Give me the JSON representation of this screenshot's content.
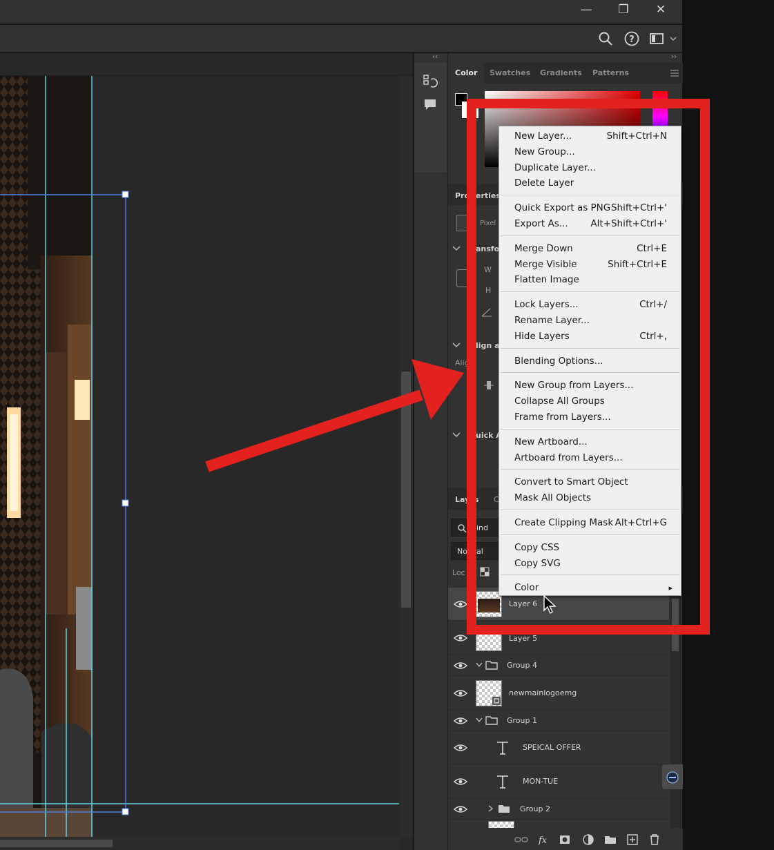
{
  "window": {
    "minimize_glyph": "—",
    "restore_glyph": "❐",
    "close_glyph": "✕"
  },
  "panel": {
    "collapse_left": "‹‹",
    "collapse_right": "››",
    "color_tabs": [
      "Color",
      "Swatches",
      "Gradients",
      "Patterns"
    ],
    "properties_label": "Pro",
    "properties_label_tail": "erties",
    "pixel_label": "Pixel",
    "transform_label": "ansfo",
    "w_label": "W",
    "h_label": "H",
    "align_label": "lign ar",
    "align_sub": "Alig",
    "quick_label": "uick A",
    "layers_tab": "Lay",
    "layers_tab_tail": "s",
    "layers_tab2": "C",
    "kind_label": "ind",
    "blend_mode": "No",
    "blend_mode_tail": "al",
    "lock_label": "Loc"
  },
  "layers": [
    {
      "name": "Layer 6",
      "type": "pixel",
      "selected": true
    },
    {
      "name": "Layer 5",
      "type": "pixel",
      "selected": false
    },
    {
      "name": "Group 4",
      "type": "group",
      "expanded": true
    },
    {
      "name": "newmainlogoemg",
      "type": "smart",
      "selected": false
    },
    {
      "name": "Group 1",
      "type": "group",
      "expanded": true
    },
    {
      "name": "SPEICAL OFFER",
      "type": "text"
    },
    {
      "name": "MON-TUE",
      "type": "text"
    },
    {
      "name": "Group 2",
      "type": "group",
      "expanded": false
    }
  ],
  "context_menu": {
    "groups": [
      [
        {
          "label": "New Layer...",
          "shortcut": "Shift+Ctrl+N"
        },
        {
          "label": "New Group...",
          "shortcut": ""
        },
        {
          "label": "Duplicate Layer...",
          "shortcut": ""
        },
        {
          "label": "Delete Layer",
          "shortcut": ""
        }
      ],
      [
        {
          "label": "Quick Export as PNG",
          "shortcut": "Shift+Ctrl+'"
        },
        {
          "label": "Export As...",
          "shortcut": "Alt+Shift+Ctrl+'"
        }
      ],
      [
        {
          "label": "Merge Down",
          "shortcut": "Ctrl+E"
        },
        {
          "label": "Merge Visible",
          "shortcut": "Shift+Ctrl+E"
        },
        {
          "label": "Flatten Image",
          "shortcut": ""
        }
      ],
      [
        {
          "label": "Lock Layers...",
          "shortcut": "Ctrl+/"
        },
        {
          "label": "Rename Layer...",
          "shortcut": ""
        },
        {
          "label": "Hide Layers",
          "shortcut": "Ctrl+,"
        }
      ],
      [
        {
          "label": "Blending Options...",
          "shortcut": ""
        }
      ],
      [
        {
          "label": "New Group from Layers...",
          "shortcut": ""
        },
        {
          "label": "Collapse All Groups",
          "shortcut": ""
        },
        {
          "label": "Frame from Layers...",
          "shortcut": ""
        }
      ],
      [
        {
          "label": "New Artboard...",
          "shortcut": ""
        },
        {
          "label": "Artboard from Layers...",
          "shortcut": ""
        }
      ],
      [
        {
          "label": "Convert to Smart Object",
          "shortcut": ""
        },
        {
          "label": "Mask All Objects",
          "shortcut": ""
        }
      ],
      [
        {
          "label": "Create Clipping Mask",
          "shortcut": "Alt+Ctrl+G"
        }
      ],
      [
        {
          "label": "Copy CSS",
          "shortcut": ""
        },
        {
          "label": "Copy SVG",
          "shortcut": ""
        }
      ],
      [
        {
          "label": "Color",
          "shortcut": "▸"
        }
      ]
    ]
  },
  "colors": {
    "annotation": "#e3221f",
    "guide": "#5fd3e0",
    "selection": "#4a7ee8",
    "panel_bg": "#323232",
    "menu_bg": "#f0f0f0"
  }
}
